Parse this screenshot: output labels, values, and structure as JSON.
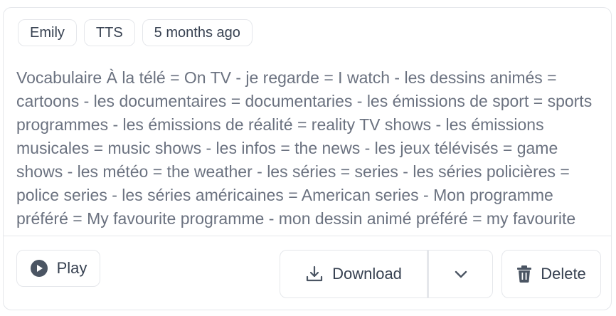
{
  "tags": [
    "Emily",
    "TTS",
    "5 months ago"
  ],
  "body_text": "Vocabulaire À la télé = On TV - je regarde = I watch - les dessins animés = cartoons - les documentaires = documentaries - les émissions de sport = sports programmes - les émissions de réalité = reality TV shows - les émissions musicales = music shows - les infos = the news - les jeux télévisés = game shows - les météo = the weather - les séries = series - les séries policières = police series - les séries américaines = American series - Mon programme préféré = My favourite programme - mon dessin animé préféré = my favourite cartoon",
  "buttons": {
    "play": "Play",
    "download": "Download",
    "delete": "Delete"
  },
  "icons": {
    "play": "play-circle-icon",
    "download": "download-icon",
    "chevron": "chevron-down-icon",
    "delete": "trash-icon"
  }
}
